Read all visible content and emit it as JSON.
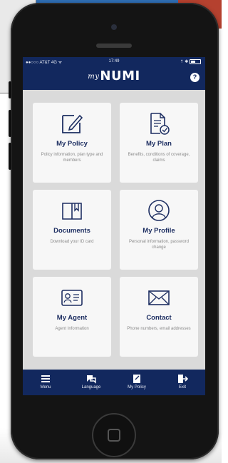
{
  "status_bar": {
    "carrier": "●●○○○ AT&T 4G ᯤ",
    "time": "17:49",
    "right": "⇡ ✱"
  },
  "app": {
    "logo_my": "my",
    "logo_name": "NUMI",
    "help_glyph": "?"
  },
  "tiles": [
    {
      "title": "My Policy",
      "subtitle": "Policy information, plan type and members",
      "icon": "edit-document-icon"
    },
    {
      "title": "My Plan",
      "subtitle": "Benefits, conditions of coverage, claims",
      "icon": "document-check-icon"
    },
    {
      "title": "Documents",
      "subtitle": "Download your ID card",
      "icon": "book-bookmark-icon"
    },
    {
      "title": "My Profile",
      "subtitle": "Personal information, password change",
      "icon": "user-circle-icon"
    },
    {
      "title": "My Agent",
      "subtitle": "Agent Information",
      "icon": "id-card-icon"
    },
    {
      "title": "Contact",
      "subtitle": "Phone numbers, email addresses",
      "icon": "envelope-icon"
    }
  ],
  "tab_bar": [
    {
      "label": "Menu",
      "icon": "hamburger-menu-icon"
    },
    {
      "label": "Language",
      "icon": "language-bubble-icon"
    },
    {
      "label": "My Policy",
      "icon": "policy-document-icon"
    },
    {
      "label": "Exit",
      "icon": "exit-door-icon"
    }
  ],
  "colors": {
    "header": "#12285e",
    "tile_title": "#1e2f62",
    "screen_bg": "#dadada",
    "tile_bg": "#f7f7f7"
  }
}
